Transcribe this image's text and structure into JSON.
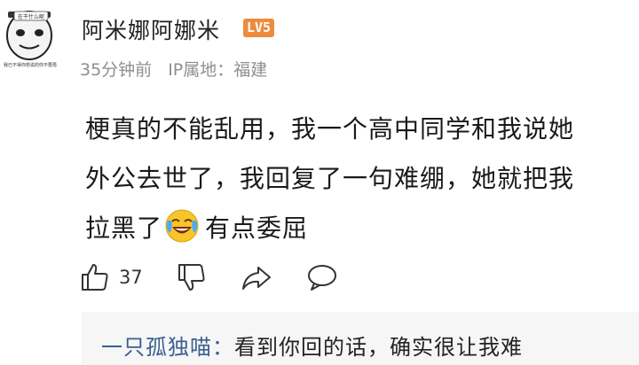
{
  "avatar": {
    "meme_caption_top": "在干什么呢",
    "meme_caption_bottom": "我已不得你想说的你不要再"
  },
  "user": {
    "name": "阿米娜阿娜米",
    "level": "LV5"
  },
  "meta": {
    "time": "35分钟前",
    "ip_location": "IP属地：福建"
  },
  "comment": {
    "line1": "梗真的不能乱用，我一个高中同学和我说她",
    "line2": "外公去世了，我回复了一句难绷，她就把我",
    "line3_before": "拉黑了",
    "line3_after": "有点委屈"
  },
  "actions": {
    "like_count": "37"
  },
  "reply": {
    "author": "一只孤独喵：",
    "text": "看到你回的话，确实很让我难"
  },
  "colors": {
    "badge": "#ef8b3c",
    "reply_author": "#3a5f8f",
    "meta": "#8f8f8f"
  }
}
